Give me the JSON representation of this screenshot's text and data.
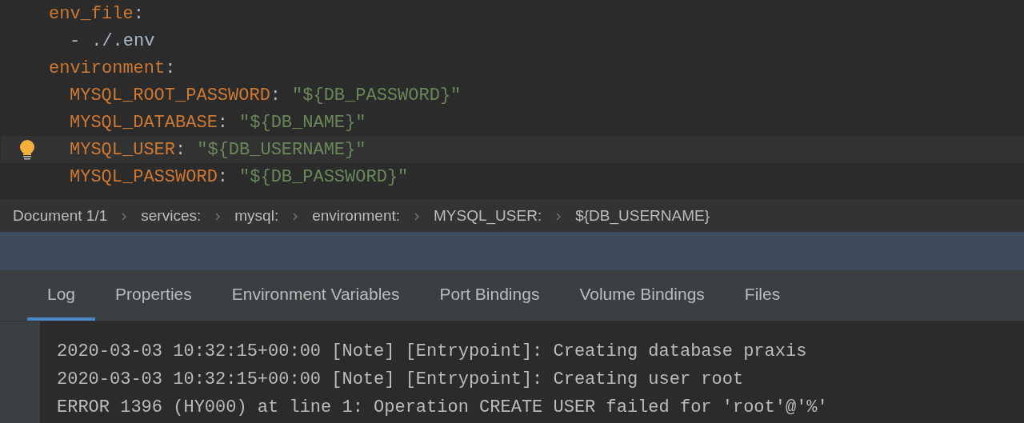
{
  "editor": {
    "lines": [
      {
        "kind": "key",
        "key": "env_file",
        "colon": ":",
        "current": false
      },
      {
        "kind": "list_item",
        "dash": "-",
        "value": "./.env",
        "current": false
      },
      {
        "kind": "key",
        "key": "environment",
        "colon": ":",
        "current": false
      },
      {
        "kind": "pair",
        "key": "MYSQL_ROOT_PASSWORD",
        "colon": ":",
        "value": "\"${DB_PASSWORD}\"",
        "current": false
      },
      {
        "kind": "pair",
        "key": "MYSQL_DATABASE",
        "colon": ":",
        "value": "\"${DB_NAME}\"",
        "current": false
      },
      {
        "kind": "pair",
        "key": "MYSQL_USER",
        "colon": ":",
        "value": "\"${DB_USERNAME}\"",
        "current": true
      },
      {
        "kind": "pair",
        "key": "MYSQL_PASSWORD",
        "colon": ":",
        "value": "\"${DB_PASSWORD}\"",
        "current": false
      }
    ]
  },
  "breadcrumbs": [
    "Document 1/1",
    "services:",
    "mysql:",
    "environment:",
    "MYSQL_USER:",
    "${DB_USERNAME}"
  ],
  "tabs": [
    {
      "label": "Log",
      "selected": true
    },
    {
      "label": "Properties",
      "selected": false
    },
    {
      "label": "Environment Variables",
      "selected": false
    },
    {
      "label": "Port Bindings",
      "selected": false
    },
    {
      "label": "Volume Bindings",
      "selected": false
    },
    {
      "label": "Files",
      "selected": false
    }
  ],
  "log": [
    "2020-03-03 10:32:15+00:00 [Note] [Entrypoint]: Creating database praxis",
    "2020-03-03 10:32:15+00:00 [Note] [Entrypoint]: Creating user root",
    "ERROR 1396 (HY000) at line 1: Operation CREATE USER failed for 'root'@'%'"
  ]
}
